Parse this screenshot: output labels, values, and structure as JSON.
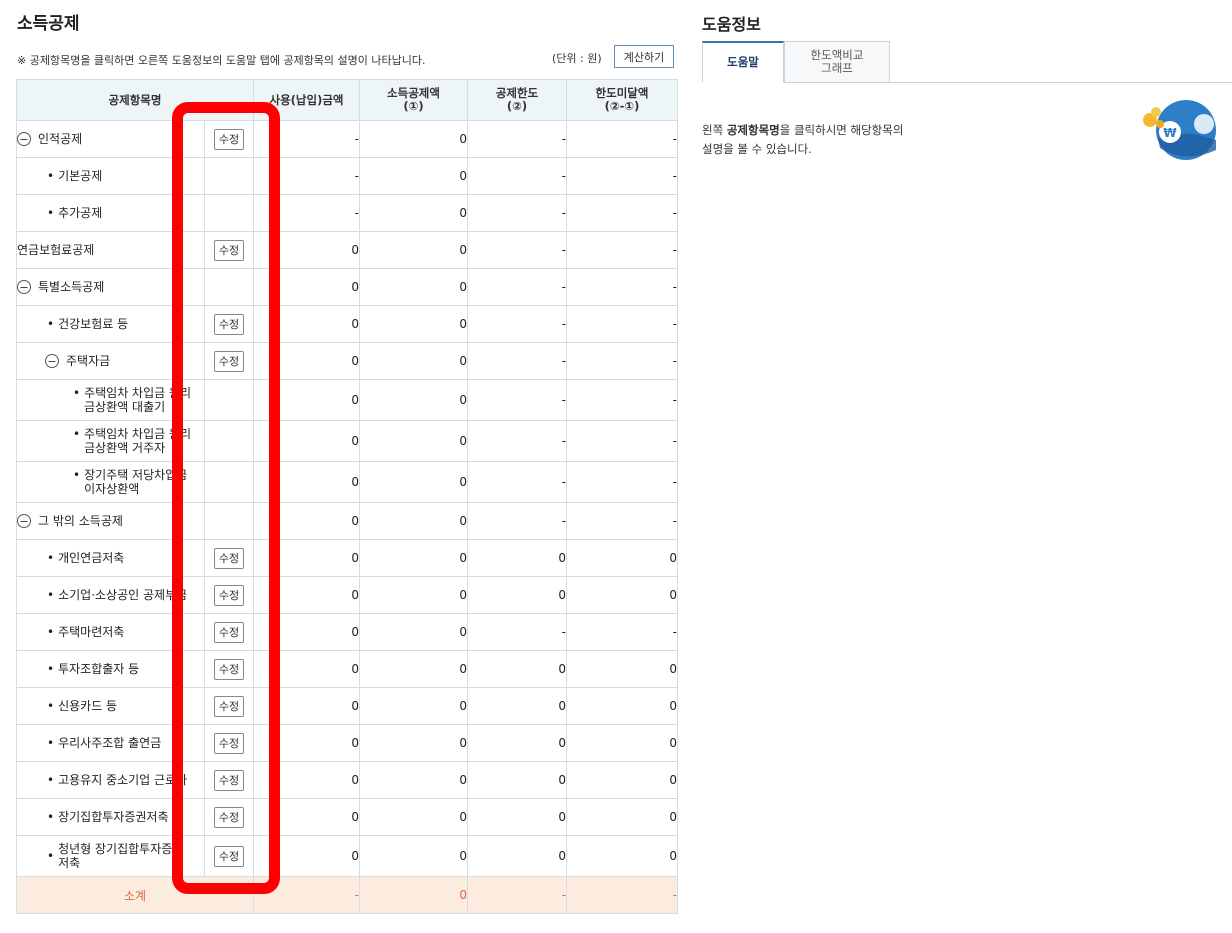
{
  "page": {
    "title": "소득공제",
    "notice": "※ 공제항목명을 클릭하면 오른쪽 도움정보의 도움말 탭에 공제항목의 설명이 나타납니다.",
    "unit": "(단위 : 원)",
    "calc_button": "계산하기"
  },
  "table": {
    "headers": {
      "item": "공제항목명",
      "paid": "사용(납입)금액",
      "deduction": "소득공제액\n(①)",
      "limit": "공제한도\n(②)",
      "shortfall": "한도미달액\n(②-①)"
    },
    "edit_label": "수정",
    "rows": [
      {
        "name": "인적공제",
        "level": 0,
        "toggle": true,
        "edit": true,
        "paid": "-",
        "deduction": "0",
        "limit": "-",
        "shortfall": "-"
      },
      {
        "name": "기본공제",
        "level": 1,
        "toggle": false,
        "edit": false,
        "paid": "-",
        "deduction": "0",
        "limit": "-",
        "shortfall": "-"
      },
      {
        "name": "추가공제",
        "level": 1,
        "toggle": false,
        "edit": false,
        "paid": "-",
        "deduction": "0",
        "limit": "-",
        "shortfall": "-"
      },
      {
        "name": "연금보험료공제",
        "level": -1,
        "toggle": false,
        "edit": true,
        "paid": "0",
        "deduction": "0",
        "limit": "-",
        "shortfall": "-"
      },
      {
        "name": "특별소득공제",
        "level": 0,
        "toggle": true,
        "edit": false,
        "paid": "0",
        "deduction": "0",
        "limit": "-",
        "shortfall": "-"
      },
      {
        "name": "건강보험료 등",
        "level": 1,
        "toggle": false,
        "edit": true,
        "paid": "0",
        "deduction": "0",
        "limit": "-",
        "shortfall": "-"
      },
      {
        "name": "주택자금",
        "level": 1,
        "toggle": true,
        "edit": true,
        "paid": "0",
        "deduction": "0",
        "limit": "-",
        "shortfall": "-"
      },
      {
        "name": "주택임차 차입금 원리\n금상환액 대출기",
        "level": 2,
        "toggle": false,
        "edit": false,
        "paid": "0",
        "deduction": "0",
        "limit": "-",
        "shortfall": "-",
        "tall": true
      },
      {
        "name": "주택임차 차입금 원리\n금상환액 거주자",
        "level": 2,
        "toggle": false,
        "edit": false,
        "paid": "0",
        "deduction": "0",
        "limit": "-",
        "shortfall": "-",
        "tall": true
      },
      {
        "name": "장기주택 저당차입금\n이자상환액",
        "level": 2,
        "toggle": false,
        "edit": false,
        "paid": "0",
        "deduction": "0",
        "limit": "-",
        "shortfall": "-",
        "tall": true
      },
      {
        "name": "그 밖의 소득공제",
        "level": 0,
        "toggle": true,
        "edit": false,
        "paid": "0",
        "deduction": "0",
        "limit": "-",
        "shortfall": "-"
      },
      {
        "name": "개인연금저축",
        "level": 1,
        "toggle": false,
        "edit": true,
        "paid": "0",
        "deduction": "0",
        "limit": "0",
        "shortfall": "0"
      },
      {
        "name": "소기업·소상공인 공제부금",
        "level": 1,
        "toggle": false,
        "edit": true,
        "paid": "0",
        "deduction": "0",
        "limit": "0",
        "shortfall": "0"
      },
      {
        "name": "주택마련저축",
        "level": 1,
        "toggle": false,
        "edit": true,
        "paid": "0",
        "deduction": "0",
        "limit": "-",
        "shortfall": "-"
      },
      {
        "name": "투자조합출자 등",
        "level": 1,
        "toggle": false,
        "edit": true,
        "paid": "0",
        "deduction": "0",
        "limit": "0",
        "shortfall": "0"
      },
      {
        "name": "신용카드 등",
        "level": 1,
        "toggle": false,
        "edit": true,
        "paid": "0",
        "deduction": "0",
        "limit": "0",
        "shortfall": "0"
      },
      {
        "name": "우리사주조합 출연금",
        "level": 1,
        "toggle": false,
        "edit": true,
        "paid": "0",
        "deduction": "0",
        "limit": "0",
        "shortfall": "0"
      },
      {
        "name": "고용유지 중소기업 근로자",
        "level": 1,
        "toggle": false,
        "edit": true,
        "paid": "0",
        "deduction": "0",
        "limit": "0",
        "shortfall": "0"
      },
      {
        "name": "장기집합투자증권저축",
        "level": 1,
        "toggle": false,
        "edit": true,
        "paid": "0",
        "deduction": "0",
        "limit": "0",
        "shortfall": "0"
      },
      {
        "name": "청년형 장기집합투자증권\n저축",
        "level": 1,
        "toggle": false,
        "edit": true,
        "paid": "0",
        "deduction": "0",
        "limit": "0",
        "shortfall": "0",
        "tall": true
      }
    ],
    "subtotal": {
      "label": "소계",
      "paid": "-",
      "deduction": "0",
      "limit": "-",
      "shortfall": "-"
    }
  },
  "help": {
    "title": "도움정보",
    "tabs": [
      "도움말",
      "한도액비교\n그래프"
    ],
    "text_prefix": "왼쪽 ",
    "text_bold": "공제항목명",
    "text_suffix": "을 클릭하시면 해당항목의",
    "text_line2": "설명을 볼 수 있습니다."
  },
  "colors": {
    "highlight": "#ff0000",
    "header_bg": "#eef5f6",
    "subtotal_bg": "#fcece0",
    "subtotal_text": "#e0683a",
    "tab_accent": "#3d6fb0"
  },
  "icons": {
    "toggle": "minus-circle-icon",
    "help_illustration": "coin-globe-icon"
  }
}
